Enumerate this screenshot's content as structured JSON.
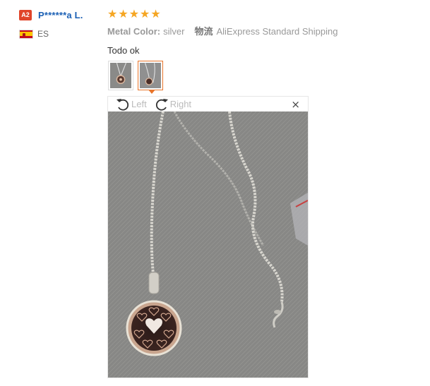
{
  "reviewer": {
    "level_badge": "A2",
    "name": "P******a L.",
    "country_code": "ES",
    "flag_icon": "spain-flag-icon"
  },
  "review": {
    "rating": 5,
    "stars": [
      "★",
      "★",
      "★",
      "★",
      "★"
    ],
    "star_color": "#f5a623",
    "metal_color_label": "Metal Color:",
    "metal_color_value": "silver",
    "shipping_label": "物流",
    "shipping_value": "AliExpress Standard Shipping",
    "text": "Todo ok"
  },
  "thumbnails": [
    {
      "name": "photo-1",
      "selected": false
    },
    {
      "name": "photo-2",
      "selected": true
    }
  ],
  "viewer": {
    "rotate_left_label": "Left",
    "rotate_right_label": "Right",
    "close_glyph": "×",
    "photo_description_icon": "necklace-photo"
  },
  "colors": {
    "accent": "#e8742a",
    "link": "#1a5fb4",
    "badge": "#e0452a"
  }
}
